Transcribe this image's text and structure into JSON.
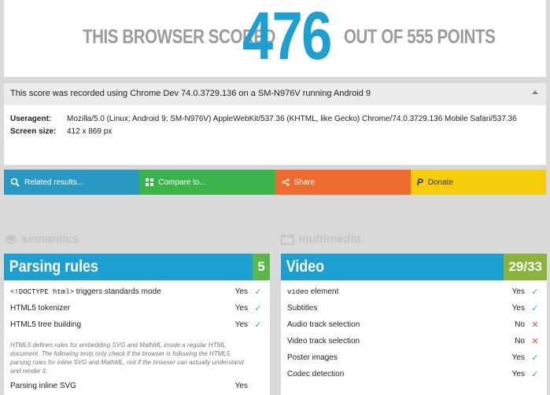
{
  "header": {
    "left_text": "THIS BROWSER SCORED",
    "score": "476",
    "right_text": "OUT OF 555 POINTS"
  },
  "recorded": {
    "text": "This score was recorded using Chrome Dev 74.0.3729.136 on a SM-N976V running Android 9"
  },
  "details": {
    "useragent_label": "Useragent:",
    "useragent_value": "Mozilla/5.0 (Linux; Android 9; SM-N976V) AppleWebKit/537.36 (KHTML, like Gecko) Chrome/74.0.3729.136 Mobile Safari/537.36",
    "screen_label": "Screen size:",
    "screen_value": "412 x 869 px"
  },
  "actions": [
    {
      "label": "Related results...",
      "icon": "search-icon",
      "color": "#2a98c4"
    },
    {
      "label": "Compare to...",
      "icon": "grid-icon",
      "color": "#3ab34a"
    },
    {
      "label": "Share",
      "icon": "share-icon",
      "color": "#ee6a2d"
    },
    {
      "label": "Donate",
      "icon": "paypal-icon",
      "color": "#f7cc0a"
    }
  ],
  "sections": {
    "semantics": "semantics",
    "multimedia": "multimedia"
  },
  "parsing": {
    "title": "Parsing rules",
    "count": "5",
    "title_color": "#1c9fd1",
    "count_color": "#5ab847",
    "rows": [
      {
        "name_code": "<!DOCTYPE html>",
        "name_rest": " triggers standards mode",
        "result": "Yes"
      },
      {
        "name": "HTML5 tokenizer",
        "result": "Yes"
      },
      {
        "name": "HTML5 tree building",
        "result": "Yes"
      }
    ],
    "note": "HTML5 defines rules for embedding SVG and MathML inside a regular HTML document. The following tests only check if the browser is following the HTML5 parsing rules for inline SVG and MathML, not if the browser can actually understand and render it.",
    "cut_row": "Parsing inline SVG",
    "cut_result": "Yes"
  },
  "video": {
    "title": "Video",
    "count": "29/33",
    "title_color": "#1c9fd1",
    "count_color": "#8bb23a",
    "rows": [
      {
        "name_code": "video",
        "name_rest": " element",
        "result": "Yes",
        "ok": true
      },
      {
        "name": "Subtitles",
        "result": "Yes",
        "ok": true
      },
      {
        "name": "Audio track selection",
        "result": "No",
        "ok": false
      },
      {
        "name": "Video track selection",
        "result": "No",
        "ok": false
      },
      {
        "name": "Poster images",
        "result": "Yes",
        "ok": true
      },
      {
        "name": "Codec detection",
        "result": "Yes",
        "ok": true
      }
    ]
  },
  "colors": {
    "score": "#1c9fd1",
    "gray_text": "#9b9b9b",
    "yes": "#4caf50",
    "no": "#d9534f"
  }
}
